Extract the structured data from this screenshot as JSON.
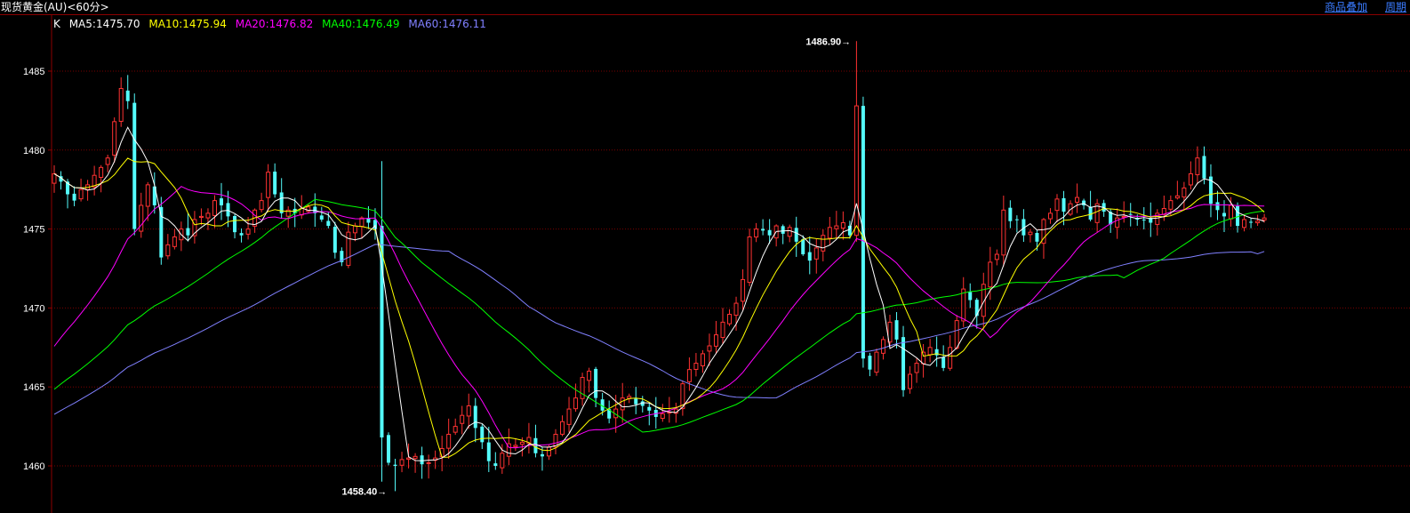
{
  "header": {
    "title": "现货黄金(AU)<60分>",
    "links": [
      "商品叠加",
      "周期"
    ]
  },
  "legend": {
    "k_label": "K",
    "items": [
      {
        "text": "MA5:1475.70",
        "color": "#ffffff"
      },
      {
        "text": "MA10:1475.94",
        "color": "#ffff00"
      },
      {
        "text": "MA20:1476.82",
        "color": "#ff00ff"
      },
      {
        "text": "MA40:1476.49",
        "color": "#00ff00"
      },
      {
        "text": "MA60:1476.11",
        "color": "#8080ff"
      }
    ]
  },
  "chart_data": {
    "type": "candlestick",
    "ylim": [
      1457.5,
      1487.5
    ],
    "yticks": [
      1460,
      1465,
      1470,
      1475,
      1480,
      1485
    ],
    "ytick_labels": [
      "1460",
      "1465",
      "1470",
      "1475",
      "1480",
      "1485"
    ],
    "grid": true,
    "up_color": "#ff3232",
    "down_color": "#54fcfc",
    "annotations": {
      "high": {
        "label": "1486.90",
        "value": 1486.9
      },
      "low": {
        "label": "1458.40",
        "value": 1458.4
      }
    },
    "close": [
      1478.5,
      1478.0,
      1477.2,
      1476.8,
      1477.5,
      1477.8,
      1478.4,
      1478.9,
      1479.5,
      1481.8,
      1483.9,
      1483.1,
      1475.0,
      1476.5,
      1477.8,
      1476.5,
      1473.2,
      1474.0,
      1474.5,
      1475.0,
      1474.6,
      1475.6,
      1475.8,
      1476.0,
      1476.8,
      1476.5,
      1475.8,
      1474.8,
      1474.6,
      1475.0,
      1476.2,
      1476.8,
      1478.6,
      1477.2,
      1476.0,
      1476.2,
      1476.0,
      1476.3,
      1476.4,
      1476.0,
      1475.6,
      1475.2,
      1473.5,
      1472.9,
      1474.8,
      1475.2,
      1475.7,
      1475.4,
      1475.0,
      1461.8,
      1460.2,
      1460.0,
      1460.4,
      1460.5,
      1460.6,
      1460.1,
      1460.2,
      1460.5,
      1461.1,
      1462.0,
      1462.5,
      1463.2,
      1463.8,
      1462.4,
      1461.5,
      1460.3,
      1460.0,
      1460.8,
      1461.4,
      1461.3,
      1461.5,
      1461.8,
      1460.8,
      1460.6,
      1461.2,
      1462.0,
      1462.8,
      1463.6,
      1464.3,
      1465.6,
      1466.0,
      1464.3,
      1463.5,
      1463.0,
      1463.6,
      1464.3,
      1464.4,
      1463.9,
      1463.8,
      1463.5,
      1463.1,
      1463.3,
      1463.4,
      1463.6,
      1465.2,
      1466.1,
      1466.5,
      1467.1,
      1467.6,
      1468.3,
      1469.1,
      1469.6,
      1470.3,
      1471.8,
      1474.5,
      1475.0,
      1474.9,
      1474.6,
      1475.2,
      1474.7,
      1475.1,
      1474.2,
      1473.4,
      1473.0,
      1473.8,
      1474.6,
      1475.1,
      1475.2,
      1475.4,
      1474.6,
      1482.8,
      1466.8,
      1466.1,
      1467.2,
      1468.0,
      1469.1,
      1468.0,
      1464.8,
      1465.8,
      1466.5,
      1467.2,
      1467.5,
      1467.0,
      1466.2,
      1467.5,
      1469.2,
      1471.2,
      1470.5,
      1469.5,
      1471.5,
      1472.9,
      1473.4,
      1476.2,
      1475.5,
      1475.6,
      1474.6,
      1474.8,
      1474.2,
      1475.6,
      1476.0,
      1476.9,
      1476.1,
      1476.6,
      1477.0,
      1476.5,
      1475.6,
      1476.6,
      1476.1,
      1475.3,
      1475.7,
      1475.8,
      1475.9,
      1475.6,
      1475.6,
      1475.4,
      1476.0,
      1476.3,
      1476.8,
      1477.1,
      1477.6,
      1478.5,
      1479.5,
      1478.2,
      1476.6,
      1476.2,
      1475.8,
      1476.5,
      1475.2,
      1475.6,
      1475.4,
      1475.5,
      1475.7
    ]
  }
}
